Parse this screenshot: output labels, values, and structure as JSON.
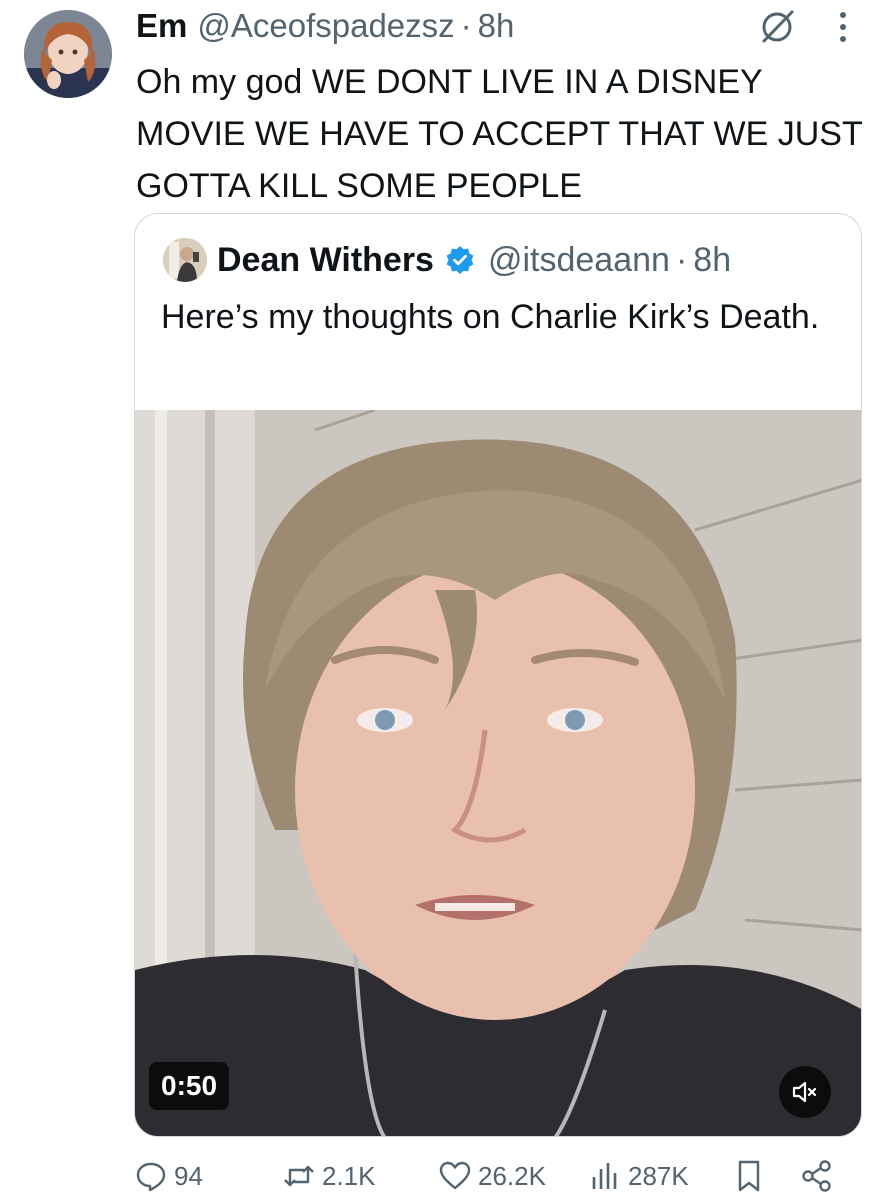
{
  "tweet": {
    "author_name": "Em",
    "author_handle": "@Aceofspadezsz",
    "separator": "·",
    "time": "8h",
    "text": "Oh my god WE DONT LIVE IN A DISNEY MOVIE WE HAVE TO ACCEPT THAT WE JUST GOTTA KILL SOME PEOPLE",
    "header_icons": [
      "grok-icon",
      "more-icon"
    ]
  },
  "quote": {
    "author_name": "Dean Withers",
    "verified": true,
    "author_handle": "@itsdeaann",
    "separator": "·",
    "time": "8h",
    "text": "Here’s my thoughts on Charlie Kirk’s Death.",
    "video": {
      "duration": "0:50",
      "muted": true
    }
  },
  "actions": {
    "replies": "94",
    "reposts": "2.1K",
    "likes": "26.2K",
    "views": "287K",
    "icons": [
      "reply-icon",
      "repost-icon",
      "like-icon",
      "views-icon",
      "bookmark-icon",
      "share-icon"
    ]
  },
  "colors": {
    "text_primary": "#0f1419",
    "text_secondary": "#536471",
    "border": "#cfd9de",
    "verified_blue": "#1d9bf0"
  }
}
